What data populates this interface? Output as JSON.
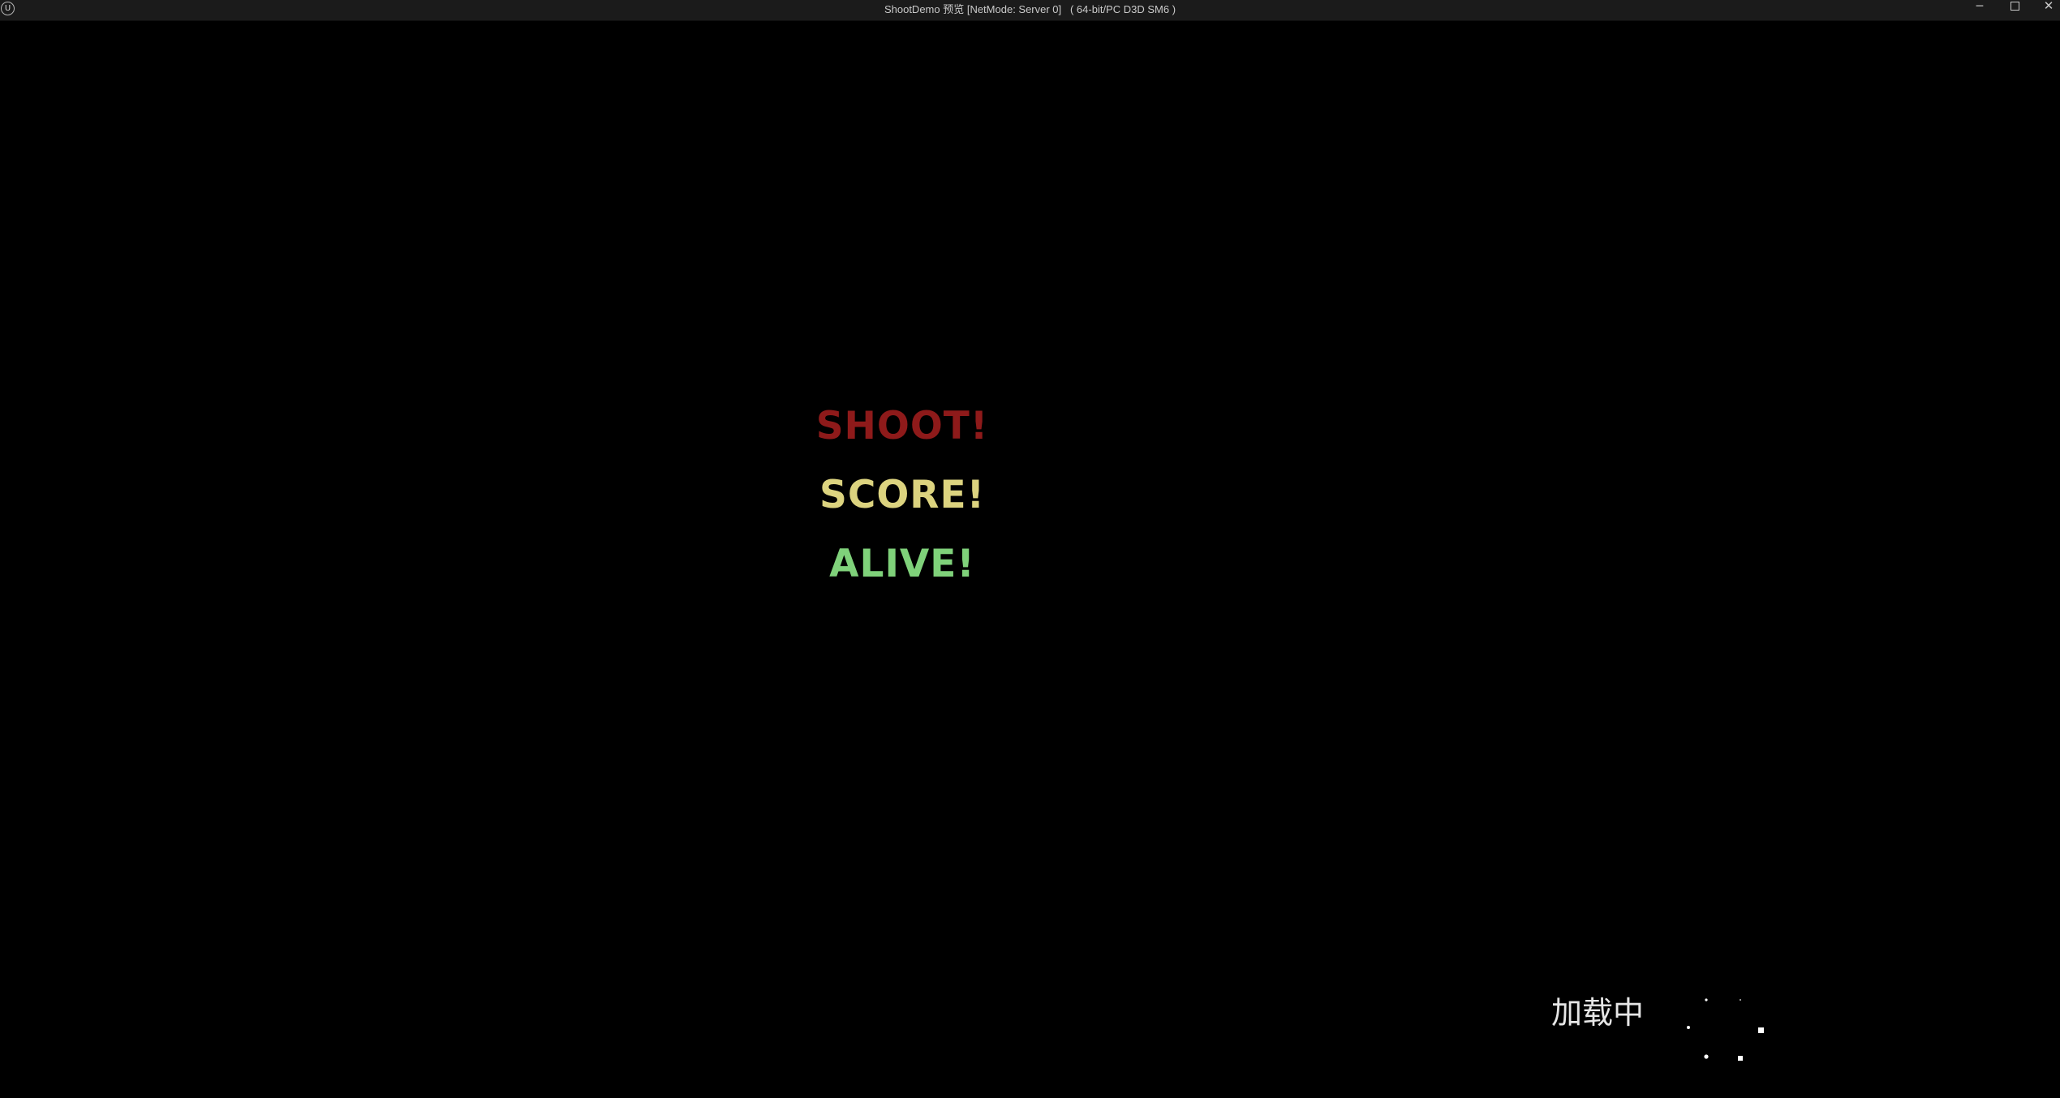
{
  "window": {
    "title": "ShootDemo 预览 [NetMode: Server 0]   ( 64-bit/PC D3D SM6 )",
    "logo_glyph": "U",
    "controls": {
      "minimize": "─",
      "close": "✕"
    }
  },
  "game": {
    "slogans": {
      "shoot": "SHOOT!",
      "score": "SCORE!",
      "alive": "ALIVE!"
    },
    "slogan_colors": {
      "shoot": "#8e1a1a",
      "score": "#dcd37f",
      "alive": "#7fd17a"
    },
    "loading_text": "加载中",
    "spinner_icon": "loading-spinner-icon"
  }
}
